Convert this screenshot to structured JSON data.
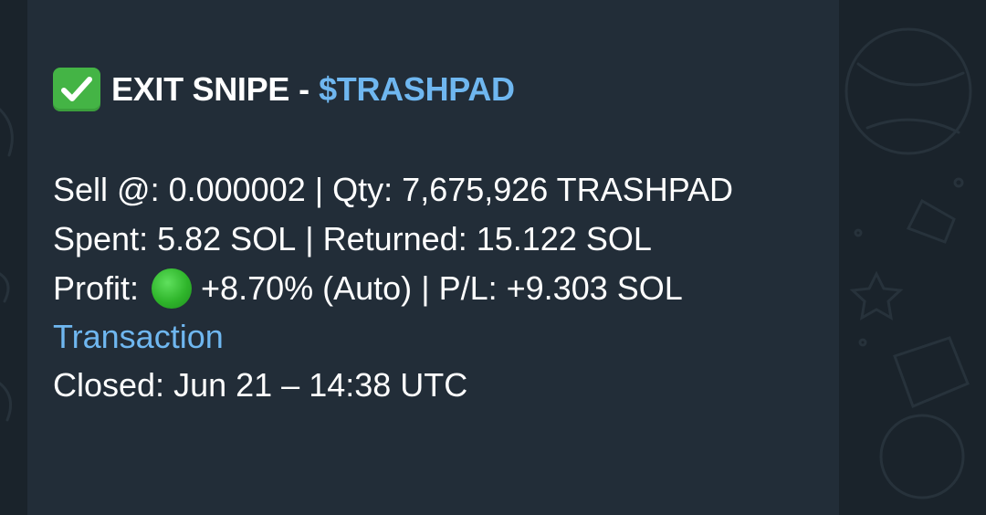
{
  "message": {
    "title_icon": "check-mark-button-icon",
    "title": "EXIT SNIPE",
    "title_sep": "-",
    "ticker": "$TRASHPAD",
    "sell": {
      "label": "Sell @:",
      "value": "0.000002",
      "sep": "|",
      "qty_label": "Qty:",
      "qty_value": "7,675,926 TRASHPAD"
    },
    "spent": {
      "label": "Spent:",
      "value": "5.82 SOL",
      "sep": "|",
      "returned_label": "Returned:",
      "returned_value": "15.122 SOL"
    },
    "profit": {
      "label": "Profit:",
      "icon": "green-circle-icon",
      "value": "+8.70% (Auto)",
      "sep": "|",
      "pl_label": "P/L:",
      "pl_value": "+9.303 SOL"
    },
    "transaction_link": "Transaction",
    "closed": {
      "label": "Closed:",
      "value": "Jun 21 – 14:38 UTC"
    }
  },
  "colors": {
    "bubble": "#222d38",
    "background": "#182229",
    "link": "#6fb7f0",
    "text": "#ffffff",
    "check_green": "#44b445"
  }
}
